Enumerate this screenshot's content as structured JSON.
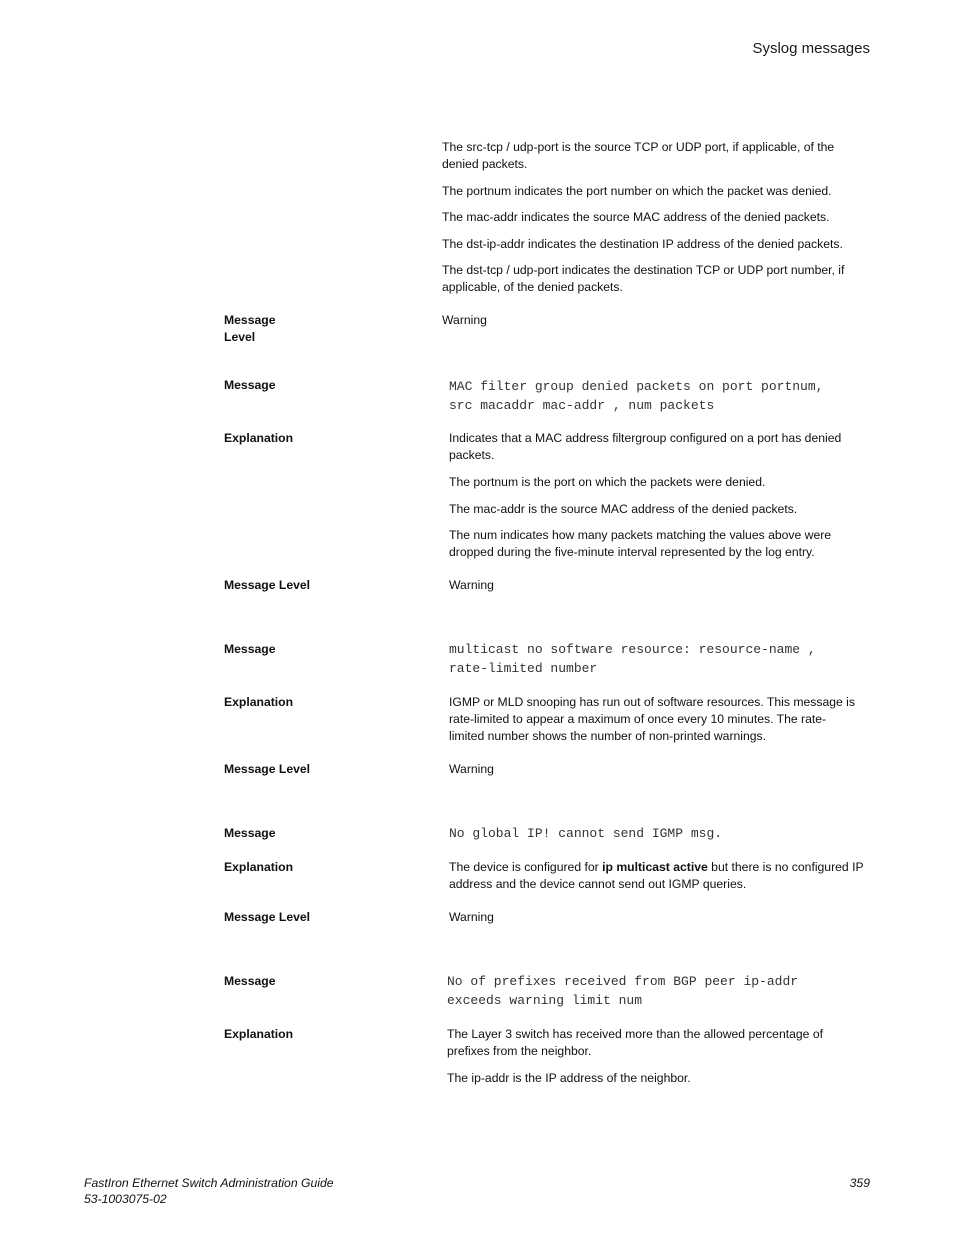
{
  "header": {
    "section_title": "Syslog messages"
  },
  "intro_paragraphs": [
    "The src-tcp / udp-port is the source TCP or UDP port, if applicable, of the denied packets.",
    "The portnum indicates the port number on which the packet was denied.",
    "The mac-addr indicates the source MAC address of the denied packets.",
    "The dst-ip-addr indicates the destination IP address of the denied packets.",
    "The dst-tcp / udp-port indicates the destination TCP or UDP port number, if applicable, of the denied packets."
  ],
  "labels": {
    "message_level_split_1": "Message",
    "message_level_split_2": "Level",
    "message": "Message",
    "explanation": "Explanation",
    "message_level": "Message Level"
  },
  "entries": [
    {
      "level": "Warning"
    },
    {
      "message_lines": [
        "MAC filter group denied packets on port portnum,",
        "src macaddr mac-addr , num packets"
      ],
      "explanation": [
        "Indicates that a MAC address filtergroup configured on a port has denied packets.",
        "The portnum is the port on which the packets were denied.",
        "The mac-addr is the source MAC address of the denied packets.",
        "The num indicates how many packets matching the values above were dropped during the five-minute interval represented by the log entry."
      ],
      "level": "Warning"
    },
    {
      "message_lines": [
        "multicast no software resource: resource-name ,",
        "rate-limited number"
      ],
      "explanation": [
        "IGMP or MLD snooping has run out of software resources. This message is rate-limited to appear a maximum of once every 10 minutes. The rate-limited number shows the number of non-printed warnings."
      ],
      "level": "Warning"
    },
    {
      "message_lines": [
        "No global IP! cannot send IGMP msg."
      ],
      "explanation_parts": {
        "before": "The device is configured for ",
        "bold": "ip multicast active",
        "after": " but there is no configured IP address and the device cannot send out IGMP queries."
      },
      "level": "Warning"
    },
    {
      "message_lines": [
        "No of prefixes received from BGP peer ip-addr",
        "exceeds warning limit num"
      ],
      "explanation": [
        "The Layer 3 switch has received more than the allowed percentage of prefixes from the neighbor.",
        "The ip-addr is the IP address of the neighbor."
      ]
    }
  ],
  "footer": {
    "guide_title": "FastIron Ethernet Switch Administration Guide",
    "doc_number": "53-1003075-02",
    "page_number": "359"
  }
}
